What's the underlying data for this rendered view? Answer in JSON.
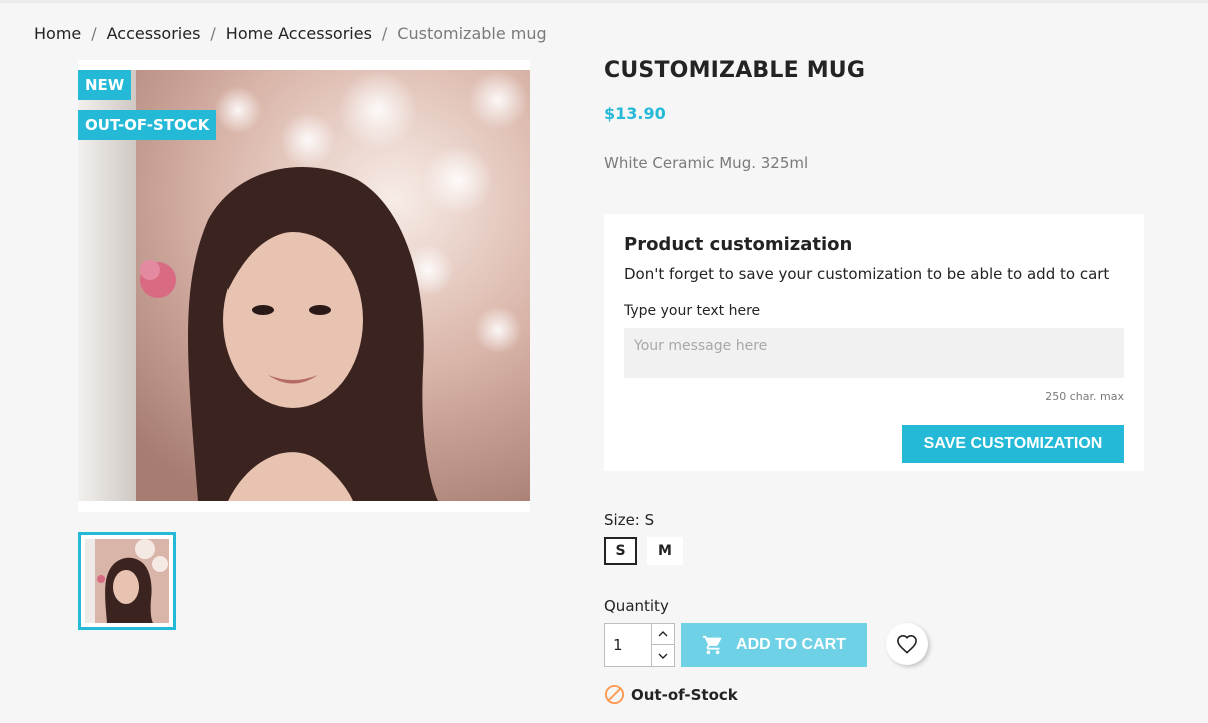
{
  "breadcrumb": {
    "home": "Home",
    "accessories": "Accessories",
    "home_accessories": "Home Accessories",
    "current": "Customizable mug",
    "separator": "/"
  },
  "product": {
    "flags": {
      "new": "NEW",
      "out_of_stock": "OUT-OF-STOCK"
    },
    "title": "CUSTOMIZABLE MUG",
    "price": "$13.90",
    "description": "White Ceramic Mug. 325ml"
  },
  "customization": {
    "title": "Product customization",
    "note": "Don't forget to save your customization to be able to add to cart",
    "field_label": "Type your text here",
    "placeholder": "Your message here",
    "char_max": "250 char. max",
    "save_label": "SAVE CUSTOMIZATION"
  },
  "size": {
    "label": "Size: S",
    "options": [
      "S",
      "M"
    ],
    "selected": "S"
  },
  "quantity": {
    "label": "Quantity",
    "value": "1"
  },
  "cart": {
    "add_label": "ADD TO CART"
  },
  "availability": {
    "text": "Out-of-Stock"
  },
  "colors": {
    "accent": "#24b9d7",
    "accent_disabled": "#6fd1e5",
    "availability_icon": "#ff9a52"
  },
  "icons": {
    "cart": "shopping-cart-icon",
    "wishlist": "heart-icon",
    "availability": "ban-icon"
  }
}
